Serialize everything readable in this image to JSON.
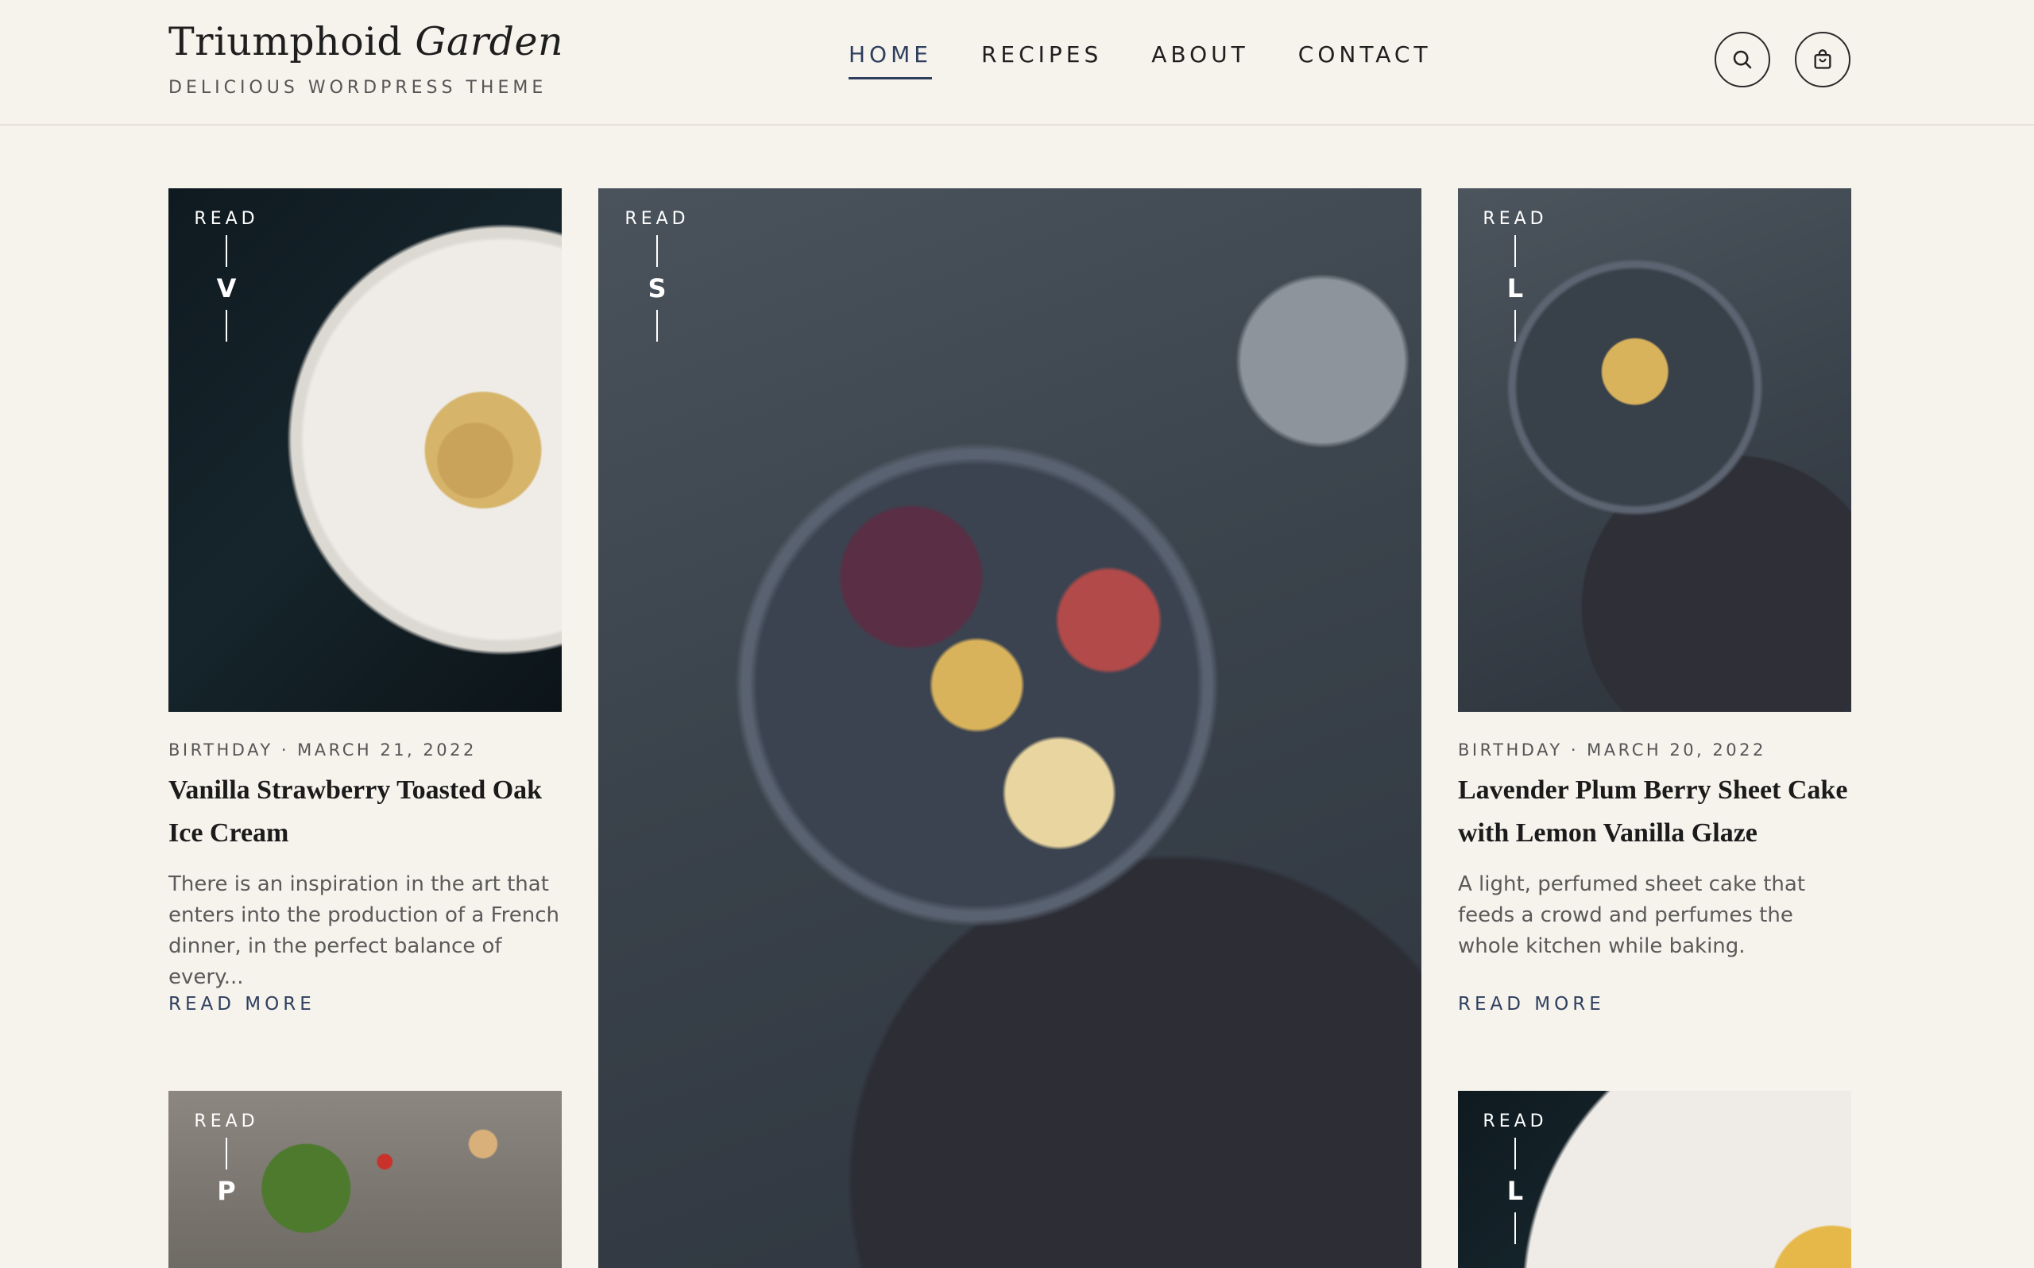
{
  "site": {
    "title_main": "Triumphoid",
    "title_italic": "Garden",
    "tagline": "DELICIOUS WORDPRESS THEME"
  },
  "nav": {
    "items": [
      {
        "label": "HOME",
        "active": true
      },
      {
        "label": "RECIPES",
        "active": false
      },
      {
        "label": "ABOUT",
        "active": false
      },
      {
        "label": "CONTACT",
        "active": false
      }
    ]
  },
  "icons": {
    "search": "search-icon",
    "cart": "shopping-bag-icon"
  },
  "posts": [
    {
      "read_label": "READ",
      "letter": "V",
      "meta": "BIRTHDAY · MARCH 21, 2022",
      "title": "Vanilla Strawberry Toasted Oak Ice Cream",
      "excerpt": "There is an inspiration in the art that enters into the production of a French dinner, in the perfect balance of every...",
      "more": "READ MORE"
    },
    {
      "read_label": "READ",
      "letter": "S"
    },
    {
      "read_label": "READ",
      "letter": "L",
      "meta": "BIRTHDAY · MARCH 20, 2022",
      "title": "Lavender Plum Berry Sheet Cake with Lemon Vanilla Glaze",
      "excerpt": "A light, perfumed sheet cake that feeds a crowd and perfumes the whole kitchen while baking.",
      "more": "READ MORE"
    },
    {
      "read_label": "READ",
      "letter": "P"
    },
    {
      "read_label": "READ",
      "letter": "L"
    }
  ],
  "colors": {
    "background": "#f6f2ec",
    "accent": "#2e3f5e",
    "text": "#1b1b1b"
  }
}
